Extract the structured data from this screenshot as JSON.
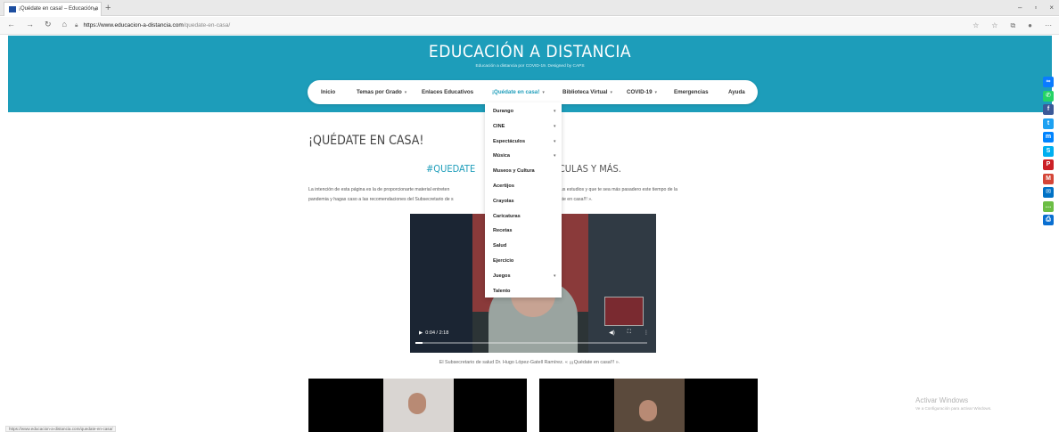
{
  "browser": {
    "tab_title": "¡Quédate en casa! – Educación a",
    "tab_close": "×",
    "new_tab": "+",
    "url_host": "https://www.educacion-a-distancia.com",
    "url_path": "/quedate-en-casa/",
    "win_minimize": "–",
    "win_restore": "▫",
    "win_close": "×"
  },
  "site": {
    "title": "EDUCACIÓN A DISTANCIA",
    "subtitle": "Educación a distancia por COVID-19. Designed by CAPS"
  },
  "nav": {
    "items": [
      {
        "label": "Inicio",
        "caret": ""
      },
      {
        "label": "Temas por Grado",
        "caret": "▾"
      },
      {
        "label": "Enlaces Educativos",
        "caret": ""
      },
      {
        "label": "¡Quédate en casa!",
        "caret": "▾"
      },
      {
        "label": "Biblioteca Virtual",
        "caret": "▾"
      },
      {
        "label": "COVID-19",
        "caret": "▾"
      },
      {
        "label": "Emergencias",
        "caret": ""
      },
      {
        "label": "Ayuda",
        "caret": ""
      }
    ]
  },
  "dropdown": {
    "items": [
      {
        "label": "Durango",
        "caret": "▾"
      },
      {
        "label": "CINE",
        "caret": "▾"
      },
      {
        "label": "Espectáculos",
        "caret": "▾"
      },
      {
        "label": "Música",
        "caret": "▾"
      },
      {
        "label": "Museos y Cultura",
        "caret": ""
      },
      {
        "label": "Acertijos",
        "caret": ""
      },
      {
        "label": "Crayolas",
        "caret": ""
      },
      {
        "label": "Caricaturas",
        "caret": ""
      },
      {
        "label": "Recetas",
        "caret": ""
      },
      {
        "label": "Salud",
        "caret": ""
      },
      {
        "label": "Ejercicio",
        "caret": ""
      },
      {
        "label": "Juegos",
        "caret": "▾"
      },
      {
        "label": "Talento",
        "caret": ""
      }
    ]
  },
  "main": {
    "heading": "¡QUÉDATE EN CASA!",
    "subheading_hash": "#QUEDATE",
    "subheading_rest": "ELÍCULAS Y MÁS.",
    "intro_line1_a": "La intención de esta página es la de proporcionarte material entreten",
    "intro_line1_b": "ges después de tus estudios y que te sea más pasadero este tiempo de la",
    "intro_line2_a": "pandemia y hagas caso a las recomendaciones del Subsecretario de s",
    "intro_line2_b": "rrez. « ¡¡¡Quédate en casa!!! ».",
    "video_time": "0:04 / 2:18",
    "video_progress": 0.03,
    "caption": "El Subsecretario de salud Dr. Hugo López-Gatell Ramírez. « ¡¡¡Quédate en casa!!! »."
  },
  "watermark": {
    "line1": "Activar Windows",
    "line2": "Ve a Configuración para activar Windows."
  },
  "status_bar": {
    "url": "https://www.educacion-a-distancia.com/quedate-en-casa/"
  },
  "share": [
    {
      "name": "copy-link",
      "color": "#0a7bff",
      "glyph": "∞"
    },
    {
      "name": "whatsapp",
      "color": "#25d366",
      "glyph": "✆"
    },
    {
      "name": "facebook",
      "color": "#3b5998",
      "glyph": "f"
    },
    {
      "name": "twitter",
      "color": "#1da1f2",
      "glyph": "t"
    },
    {
      "name": "messenger",
      "color": "#0084ff",
      "glyph": "m"
    },
    {
      "name": "skype",
      "color": "#00aff0",
      "glyph": "S"
    },
    {
      "name": "pinterest",
      "color": "#cb2027",
      "glyph": "P"
    },
    {
      "name": "gmail",
      "color": "#d44638",
      "glyph": "M"
    },
    {
      "name": "email",
      "color": "#0072c6",
      "glyph": "✉"
    },
    {
      "name": "sms",
      "color": "#6cbe45",
      "glyph": "…"
    },
    {
      "name": "print",
      "color": "#0a6fd1",
      "glyph": "⎙"
    }
  ]
}
